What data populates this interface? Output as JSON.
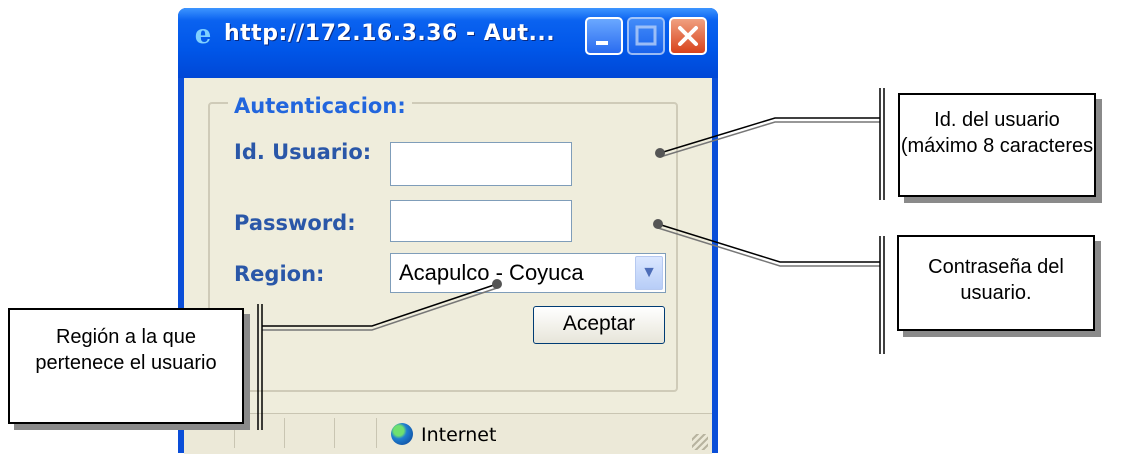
{
  "window": {
    "title": "http://172.16.3.36 - Aut..."
  },
  "form": {
    "legend": "Autenticacion:",
    "user_label": "Id. Usuario:",
    "user_value": "",
    "password_label": "Password:",
    "password_value": "",
    "region_label": "Region:",
    "region_value": "Acapulco - Coyuca",
    "submit_label": "Aceptar"
  },
  "statusbar": {
    "zone": "Internet"
  },
  "callouts": {
    "user": "Id. del usuario (máximo 8 caracteres",
    "password": "Contraseña del usuario.",
    "region": "Región a la que pertenece el usuario"
  },
  "colors": {
    "titlebar": "#0a4ed8",
    "label": "#2a57a8",
    "legend": "#2266dd",
    "client_bg": "#efeddc"
  },
  "icons": {
    "title": "ie-icon",
    "minimize": "minimize-icon",
    "maximize": "maximize-icon",
    "close": "close-icon",
    "dropdown": "chevron-down-icon",
    "zone": "globe-icon"
  }
}
